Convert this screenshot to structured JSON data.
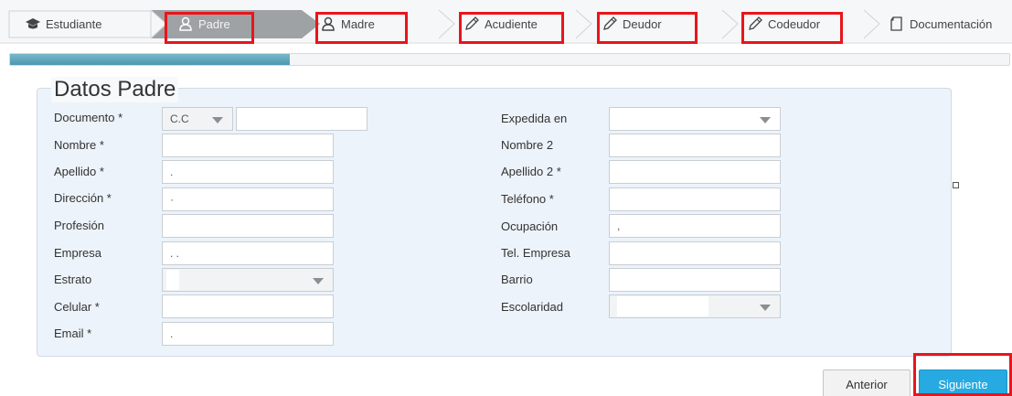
{
  "steps": [
    {
      "label": "Estudiante",
      "icon": "graduation-cap-icon",
      "active": false
    },
    {
      "label": "Padre",
      "icon": "user-icon",
      "active": true
    },
    {
      "label": "Madre",
      "icon": "user-icon",
      "active": false
    },
    {
      "label": "Acudiente",
      "icon": "pencil-icon",
      "active": false
    },
    {
      "label": "Deudor",
      "icon": "pencil-icon",
      "active": false
    },
    {
      "label": "Codeudor",
      "icon": "pencil-icon",
      "active": false
    },
    {
      "label": "Documentación",
      "icon": "document-icon",
      "active": false
    }
  ],
  "progress": {
    "percent": 28
  },
  "form": {
    "title": "Datos Padre",
    "left": {
      "documento_label": "Documento *",
      "documento_type": "C.C",
      "documento_value": "",
      "nombre_label": "Nombre *",
      "apellido_label": "Apellido *",
      "apellido_value": ".",
      "direccion_label": "Dirección *",
      "direccion_value": "·",
      "profesion_label": "Profesión",
      "empresa_label": "Empresa",
      "empresa_value": ". .",
      "estrato_label": "Estrato",
      "celular_label": "Celular *",
      "email_label": "Email *",
      "email_value": "."
    },
    "right": {
      "expedida_label": "Expedida en",
      "nombre2_label": "Nombre 2",
      "apellido2_label": "Apellido 2 *",
      "telefono_label": "Teléfono *",
      "ocupacion_label": "Ocupación",
      "ocupacion_value": ",",
      "tel_empresa_label": "Tel. Empresa",
      "barrio_label": "Barrio",
      "escolaridad_label": "Escolaridad"
    }
  },
  "buttons": {
    "prev": "Anterior",
    "next": "Siguiente"
  },
  "colors": {
    "highlight": "#e8151c",
    "active_step": "#9b9fa2",
    "primary": "#27a9e1",
    "progress": "#5aa6bd"
  }
}
